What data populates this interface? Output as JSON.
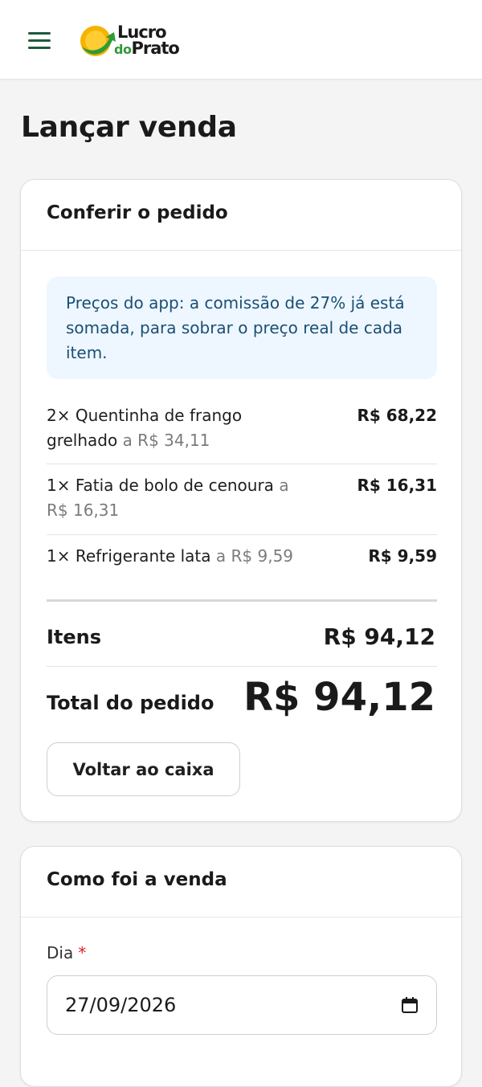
{
  "header": {
    "logo_line1": "Lucro",
    "logo_do": "do",
    "logo_line2": "Prato"
  },
  "page": {
    "title": "Lançar venda"
  },
  "order_card": {
    "title": "Conferir o pedido",
    "info": "Preços do app: a comissão de 27% já está somada, para sobrar o preço real de cada item.",
    "items": [
      {
        "qty_name_line1": "2× Quentinha de frango",
        "qty_name_line2": "grelhado",
        "unit": "a R$ 34,11",
        "total": "R$ 68,22"
      },
      {
        "qty_name_line1": "1× Fatia de bolo de cenoura",
        "unit_inline": "a",
        "unit": "R$ 16,31",
        "total": "R$ 16,31"
      },
      {
        "qty_name_line1": "1× Refrigerante lata",
        "unit": "a R$ 9,59",
        "total": "R$ 9,59"
      }
    ],
    "items_label": "Itens",
    "items_value": "R$ 94,12",
    "total_label": "Total do pedido",
    "total_value": "R$ 94,12",
    "back_button": "Voltar ao caixa"
  },
  "sale_card": {
    "title": "Como foi a venda",
    "day_label": "Dia",
    "required_mark": "*",
    "day_value": "27/09/2026"
  },
  "colors": {
    "brand_green": "#1f5a3a",
    "info_bg": "#eef7ff",
    "info_text": "#1a4f73",
    "required": "#dd2222"
  }
}
